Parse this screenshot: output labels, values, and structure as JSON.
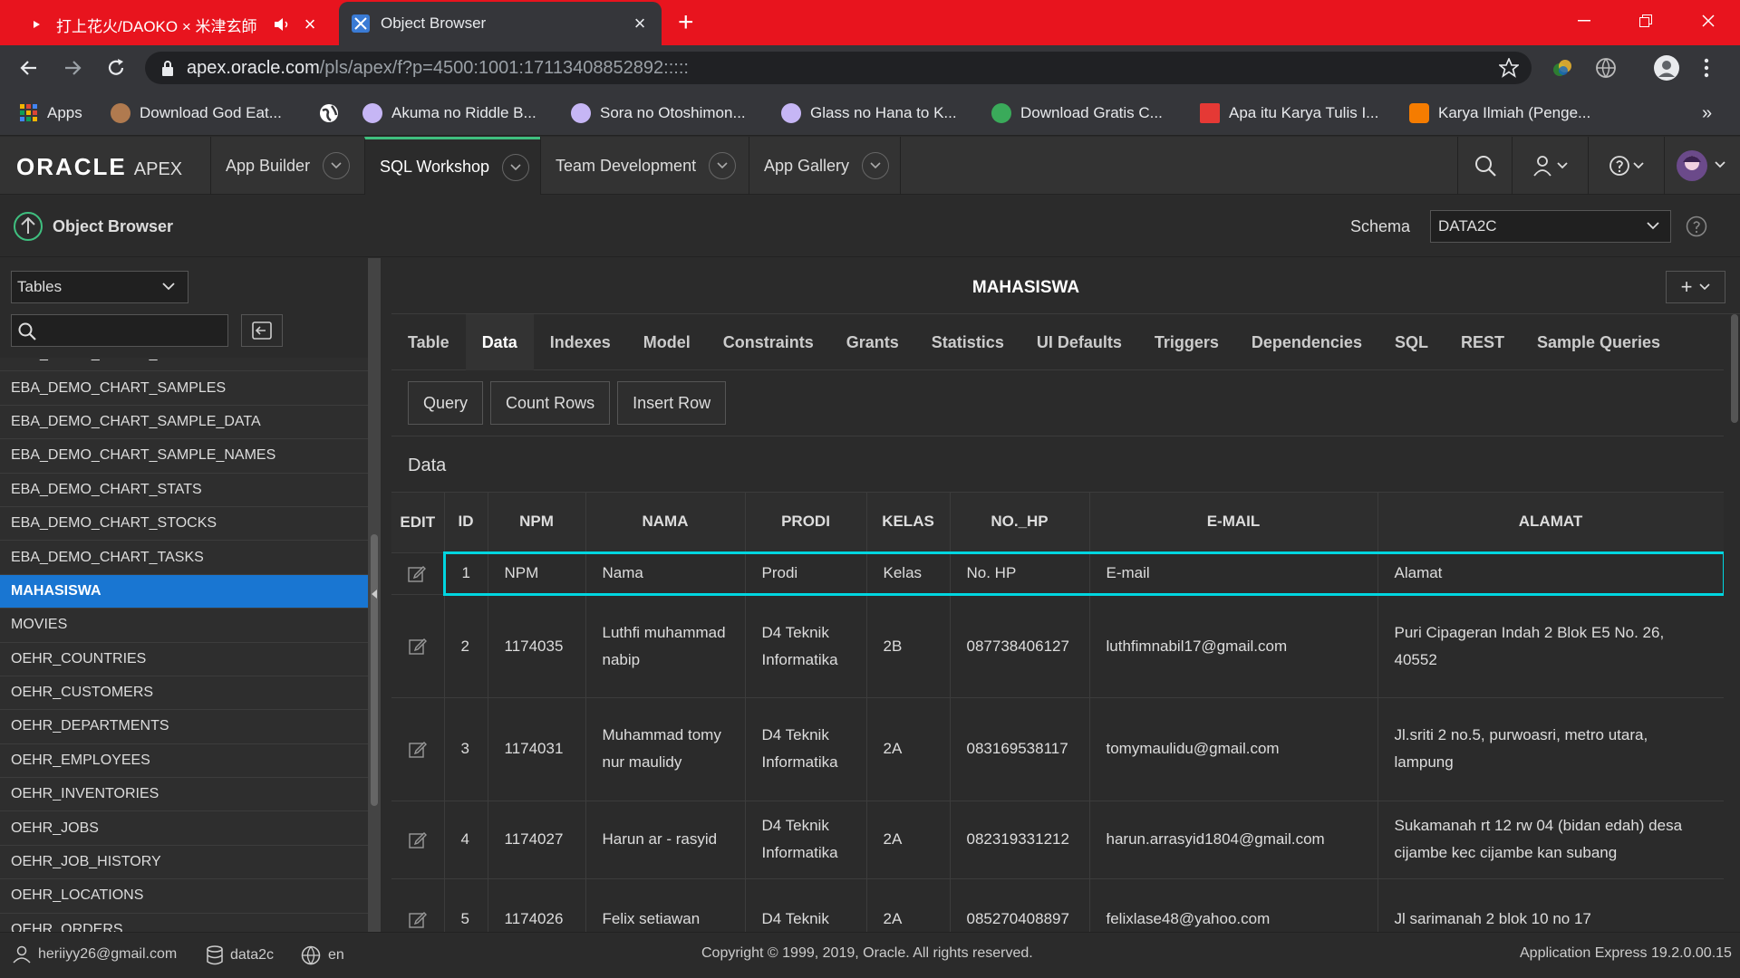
{
  "browser": {
    "tabs": [
      {
        "title": "打上花火/DAOKO × 米津玄師",
        "active": false
      },
      {
        "title": "Object Browser",
        "active": true
      }
    ],
    "url_host": "apex.oracle.com",
    "url_path": "/pls/apex/f?p=4500:1001:17113408852892:::::",
    "bookmarks": [
      {
        "label": "Apps",
        "icon": "apps-grid-icon",
        "color": "#f4b400"
      },
      {
        "label": "Download God Eat...",
        "icon": "site-icon",
        "color": "#b07a4f"
      },
      {
        "label": "",
        "icon": "globe-icon",
        "color": "#ffffff"
      },
      {
        "label": "Akuma no Riddle B...",
        "icon": "anime-site-icon",
        "color": "#c6b6f5"
      },
      {
        "label": "Sora no Otoshimon...",
        "icon": "anime-site-icon",
        "color": "#c6b6f5"
      },
      {
        "label": "Glass no Hana to K...",
        "icon": "anime-site-icon",
        "color": "#c6b6f5"
      },
      {
        "label": "Download Gratis C...",
        "icon": "green-site-icon",
        "color": "#3aaa5a"
      },
      {
        "label": "Apa itu Karya Tulis I...",
        "icon": "red-doc-icon",
        "color": "#e53935"
      },
      {
        "label": "Karya Ilmiah (Penge...",
        "icon": "blogger-icon",
        "color": "#f57c00"
      }
    ]
  },
  "apex": {
    "logo_oracle": "ORACLE",
    "logo_apex": "APEX",
    "menus": [
      {
        "label": "App Builder",
        "active": false
      },
      {
        "label": "SQL Workshop",
        "active": true
      },
      {
        "label": "Team Development",
        "active": false
      },
      {
        "label": "App Gallery",
        "active": false
      }
    ],
    "page_title": "Object Browser",
    "schema_label": "Schema",
    "schema_value": "DATA2C"
  },
  "sidebar": {
    "object_type": "Tables",
    "search_placeholder": "",
    "objects": [
      "EBA_DEMO_CHART_PRODUCTS",
      "EBA_DEMO_CHART_SAMPLES",
      "EBA_DEMO_CHART_SAMPLE_DATA",
      "EBA_DEMO_CHART_SAMPLE_NAMES",
      "EBA_DEMO_CHART_STATS",
      "EBA_DEMO_CHART_STOCKS",
      "EBA_DEMO_CHART_TASKS",
      "MAHASISWA",
      "MOVIES",
      "OEHR_COUNTRIES",
      "OEHR_CUSTOMERS",
      "OEHR_DEPARTMENTS",
      "OEHR_EMPLOYEES",
      "OEHR_INVENTORIES",
      "OEHR_JOBS",
      "OEHR_JOB_HISTORY",
      "OEHR_LOCATIONS",
      "OEHR_ORDERS"
    ],
    "active_object": "MAHASISWA"
  },
  "main": {
    "object_name": "MAHASISWA",
    "tabs": [
      "Table",
      "Data",
      "Indexes",
      "Model",
      "Constraints",
      "Grants",
      "Statistics",
      "UI Defaults",
      "Triggers",
      "Dependencies",
      "SQL",
      "REST",
      "Sample Queries"
    ],
    "active_tab": "Data",
    "buttons": [
      "Query",
      "Count Rows",
      "Insert Row"
    ],
    "section_label": "Data",
    "columns": [
      "EDIT",
      "ID",
      "NPM",
      "NAMA",
      "PRODI",
      "KELAS",
      "NO._HP",
      "E-MAIL",
      "ALAMAT"
    ],
    "rows": [
      {
        "id": "1",
        "npm": "NPM",
        "nama": "Nama",
        "prodi": "Prodi",
        "kelas": "Kelas",
        "hp": "No. HP",
        "email": "E-mail",
        "alamat": "Alamat",
        "highlight": true
      },
      {
        "id": "2",
        "npm": "1174035",
        "nama": "Luthfi muhammad nabip",
        "prodi": "D4 Teknik Informatika",
        "kelas": "2B",
        "hp": "087738406127",
        "email": "luthfimnabil17@gmail.com",
        "alamat": "Puri Cipageran Indah 2 Blok E5 No. 26, 40552"
      },
      {
        "id": "3",
        "npm": "1174031",
        "nama": "Muhammad tomy nur maulidy",
        "prodi": "D4 Teknik Informatika",
        "kelas": "2A",
        "hp": "083169538117",
        "email": "tomymaulidu@gmail.com",
        "alamat": "Jl.sriti 2 no.5, purwoasri, metro utara, lampung"
      },
      {
        "id": "4",
        "npm": "1174027",
        "nama": "Harun ar - rasyid",
        "prodi": "D4 Teknik Informatika",
        "kelas": "2A",
        "hp": "082319331212",
        "email": "harun.arrasyid1804@gmail.com",
        "alamat": "Sukamanah rt 12 rw 04 (bidan edah) desa cijambe kec cijambe kan subang"
      },
      {
        "id": "5",
        "npm": "1174026",
        "nama": "Felix setiawan",
        "prodi": "D4 Teknik",
        "kelas": "2A",
        "hp": "085270408897",
        "email": "felixlase48@yahoo.com",
        "alamat": "Jl sarimanah 2 blok 10 no 17"
      }
    ]
  },
  "footer": {
    "user": "heriiyy26@gmail.com",
    "workspace": "data2c",
    "language": "en",
    "copyright": "Copyright © 1999, 2019, Oracle. All rights reserved.",
    "version": "Application Express 19.2.0.00.15"
  },
  "colors": {
    "brand_red": "#e8141e",
    "active_blue": "#1976d2",
    "highlight_cyan": "#00d6e0",
    "accent_green": "#3fbf7f"
  }
}
